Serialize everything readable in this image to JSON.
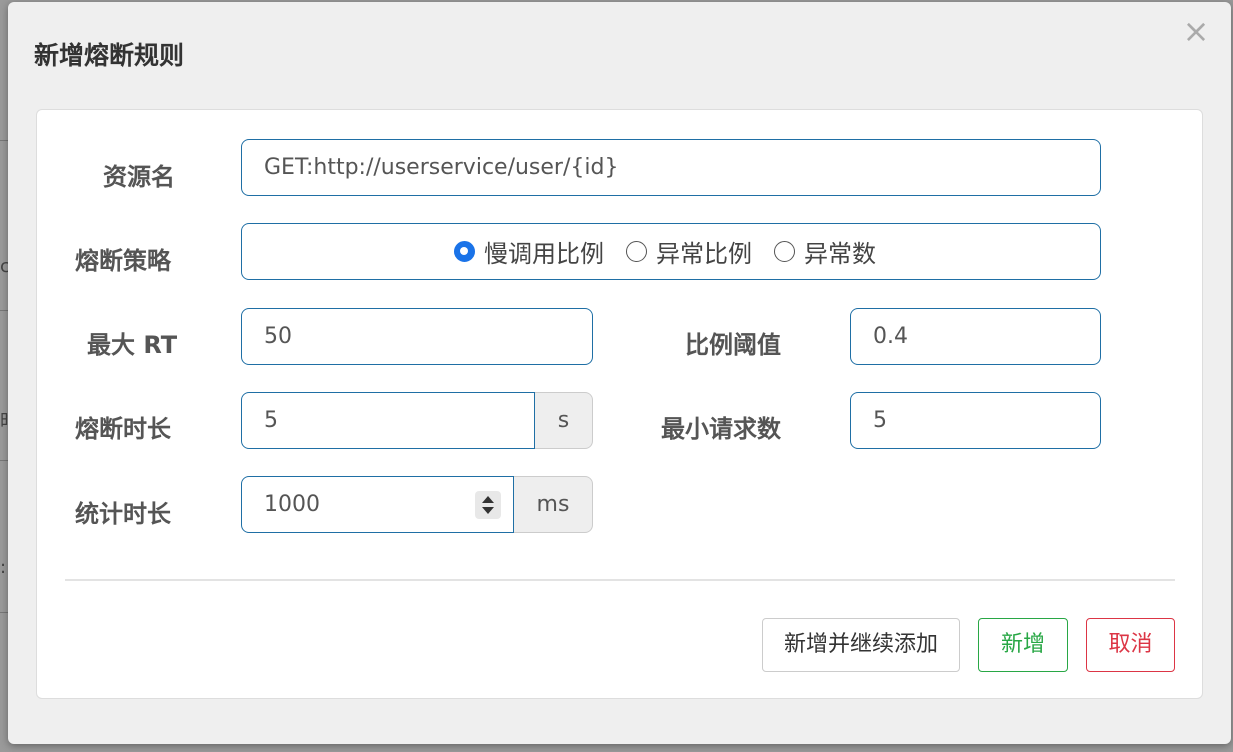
{
  "dialog": {
    "title": "新增熔断规则",
    "close_glyph": "×"
  },
  "background": {
    "fragments": [
      "c",
      "时",
      ":"
    ]
  },
  "form": {
    "resource": {
      "label": "资源名",
      "value": "GET:http://userservice/user/{id}"
    },
    "strategy": {
      "label": "熔断策略",
      "options": [
        {
          "label": "慢调用比例",
          "checked": true
        },
        {
          "label": "异常比例",
          "checked": false
        },
        {
          "label": "异常数",
          "checked": false
        }
      ]
    },
    "max_rt": {
      "label": "最大 RT",
      "value": "50"
    },
    "ratio_threshold": {
      "label": "比例阈值",
      "value": "0.4"
    },
    "break_duration": {
      "label": "熔断时长",
      "value": "5",
      "unit": "s"
    },
    "min_requests": {
      "label": "最小请求数",
      "value": "5"
    },
    "stat_duration": {
      "label": "统计时长",
      "value": "1000",
      "unit": "ms"
    }
  },
  "buttons": {
    "add_continue": "新增并继续添加",
    "add": "新增",
    "cancel": "取消"
  },
  "colors": {
    "primary": "#1a73e8",
    "input_border": "#1f6fa5",
    "success": "#28a745",
    "danger": "#dc3545"
  }
}
